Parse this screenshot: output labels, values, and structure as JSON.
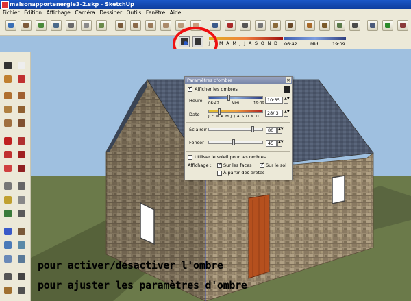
{
  "window": {
    "title": "maisonapportenergie3-2.skp - SketchUp"
  },
  "menu": [
    "Fichier",
    "Édition",
    "Affichage",
    "Caméra",
    "Dessiner",
    "Outils",
    "Fenêtre",
    "Aide"
  ],
  "shadow_toolbar": {
    "months": "J F M A M J J A S O N D",
    "time_start": "06:42",
    "time_mid": "Midi",
    "time_end": "19:09"
  },
  "dialog": {
    "title": "Paramètres d'ombre",
    "show_shadows": "Afficher les ombres",
    "hour_label": "Heure",
    "hour_start": "06:42",
    "hour_mid": "Midi",
    "hour_end": "19:09",
    "hour_value": "10:35",
    "date_label": "Date",
    "date_months": "J F M A M J J A S O N D",
    "date_value": "28/ 3",
    "light_label": "Éclaircir",
    "light_value": "80",
    "dark_label": "Foncer",
    "dark_value": "45",
    "use_sun": "Utiliser le soleil pour les ombres",
    "display_label": "Affichage :",
    "on_faces": "Sur les faces",
    "on_ground": "Sur le sol",
    "from_edges": "À partir des arêtes"
  },
  "captions": {
    "line1": "pour activer/désactiver l'ombre",
    "line2": "pour ajuster les paramètres d'ombre"
  },
  "colors": {
    "sky": "#9fc0e0",
    "ground": "#6b7a4a",
    "roof": "#4f5a6e",
    "stone": "#9a8a70",
    "door": "#b5501e",
    "highlight_circle": "#ee1111"
  }
}
